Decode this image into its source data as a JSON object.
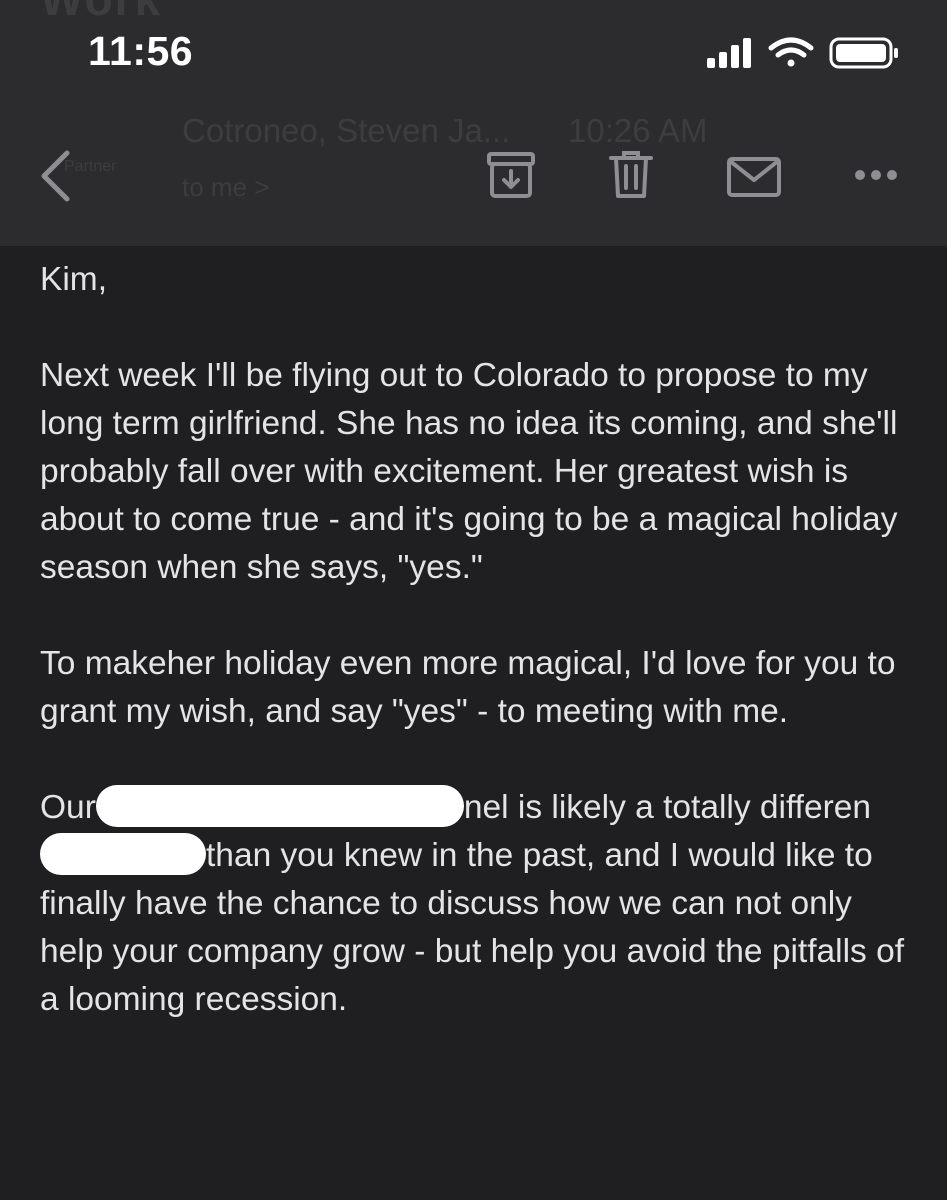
{
  "status_bar": {
    "time": "11:56",
    "icons": [
      "cellular-signal-icon",
      "wifi-icon",
      "battery-icon"
    ]
  },
  "email_header": {
    "ghost_title": "Work",
    "sender": "Cotroneo, Steven Ja...",
    "time": "10:26 AM",
    "recipient": "to me >",
    "sender_label": "Partner"
  },
  "toolbar": {
    "icons": [
      "back-chevron-icon",
      "archive-icon",
      "trash-icon",
      "mail-icon",
      "more-icon"
    ]
  },
  "email_body": {
    "greeting": "Kim,",
    "paragraph_1": "Next week I'll be flying out to Colorado to propose to my long term girlfriend. She has no idea its coming, and she'll probably fall over with excitement. Her greatest wish is about to come true - and it's going to be a magical holiday season when she says, \"yes.\"",
    "paragraph_2": "To makeher holiday even more magical, I'd love for you to grant my wish, and say \"yes\" - to meeting with me.",
    "paragraph_3_part_1": "Our",
    "paragraph_3_part_2": "nel is likely a totally differen",
    "paragraph_3_part_3": "than you knew in the past, and I would like to finally have the chance to discuss how we can not only help your company grow - but help you avoid the pitfalls of a looming recession."
  },
  "colors": {
    "background": "#1f1f21",
    "header_background": "#2c2c2e",
    "text": "#e4e4e6",
    "icon": "#8e8e93",
    "redaction": "#ffffff"
  }
}
